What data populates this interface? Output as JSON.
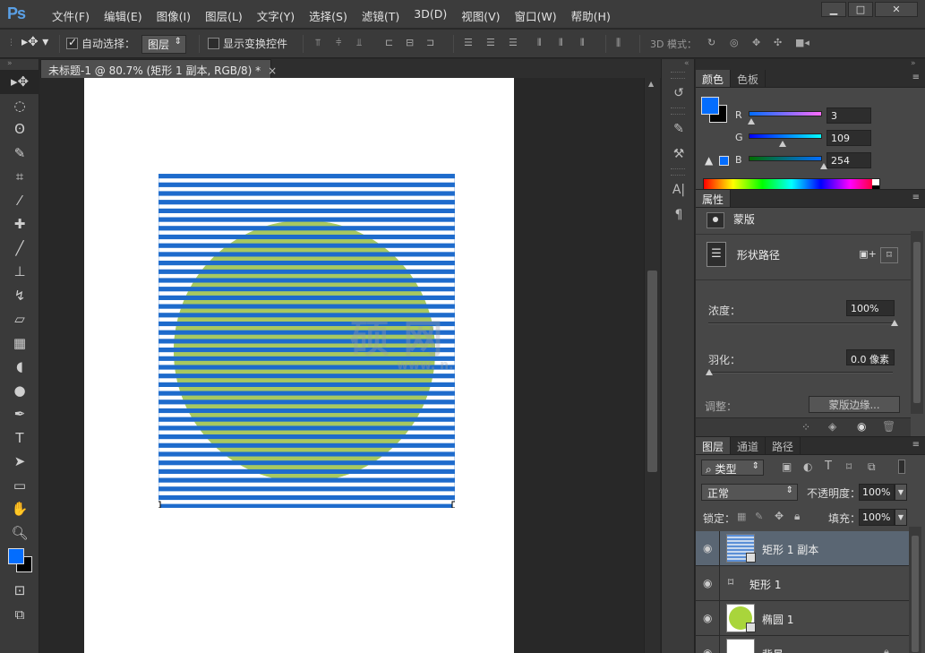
{
  "app": {
    "logo": "Ps",
    "menu": [
      "文件(F)",
      "编辑(E)",
      "图像(I)",
      "图层(L)",
      "文字(Y)",
      "选择(S)",
      "滤镜(T)",
      "3D(D)",
      "视图(V)",
      "窗口(W)",
      "帮助(H)"
    ],
    "window_controls": [
      "▁",
      "□",
      "✕"
    ]
  },
  "options": {
    "auto_select_label": "自动选择：",
    "auto_select_value": "图层",
    "show_transform_label": "显示变换控件",
    "mode_3d_label": "3D 模式："
  },
  "document": {
    "tab_title": "未标题-1 @ 80.7% (矩形 1 副本, RGB/8) *",
    "tab_close": "×",
    "watermark": "硕      网",
    "watermark_url": "www.           n."
  },
  "color_panel": {
    "tabs": [
      "颜色",
      "色板"
    ],
    "r_label": "R",
    "r_value": "3",
    "g_label": "G",
    "g_value": "109",
    "b_label": "B",
    "b_value": "254",
    "fg_color": "#036dfe",
    "bg_color": "#000000"
  },
  "properties_panel": {
    "tab": "属性",
    "mask_label": "蒙版",
    "shape_path_label": "形状路径",
    "density_label": "浓度：",
    "density_value": "100%",
    "feather_label": "羽化：",
    "feather_value": "0.0 像素",
    "adjust_label": "调整：",
    "mask_edge_button": "蒙版边缘..."
  },
  "layers_panel": {
    "tabs": [
      "图层",
      "通道",
      "路径"
    ],
    "filter_kind": "类型",
    "blend_mode": "正常",
    "opacity_label": "不透明度：",
    "opacity_value": "100%",
    "lock_label": "锁定：",
    "fill_label": "填充：",
    "fill_value": "100%",
    "layers": [
      {
        "name": "矩形 1 副本",
        "selected": true
      },
      {
        "name": "矩形 1",
        "selected": false
      },
      {
        "name": "椭圆 1",
        "selected": false
      },
      {
        "name": "背景",
        "selected": false
      }
    ]
  },
  "canvas_colors": {
    "stripe": "#1e6bcc",
    "circle": "#a8c860",
    "circle_under": "#95d36e"
  }
}
